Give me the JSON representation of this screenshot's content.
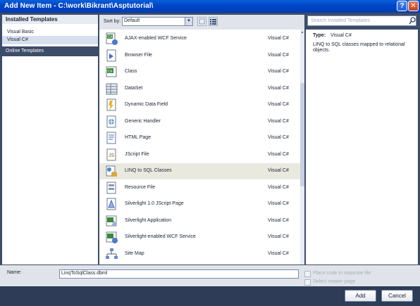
{
  "window": {
    "title": "Add New Item - C:\\work\\Bikrant\\Asptutorial\\",
    "help_glyph": "?",
    "close_glyph": "✕"
  },
  "left_panel": {
    "header": "Installed Templates",
    "items": [
      {
        "label": "Visual Basic",
        "selected": false
      },
      {
        "label": "Visual C#",
        "selected": true
      }
    ],
    "online": "Online Templates"
  },
  "toolbar": {
    "sort_label": "Sort by:",
    "sort_value": "Default"
  },
  "search": {
    "placeholder": "Search Installed Templates"
  },
  "templates": [
    {
      "name": "AJAX-enabled WCF Service",
      "lang": "Visual C#",
      "icon": "wcf-service-icon"
    },
    {
      "name": "Browser File",
      "lang": "Visual C#",
      "icon": "browser-file-icon"
    },
    {
      "name": "Class",
      "lang": "Visual C#",
      "icon": "class-icon"
    },
    {
      "name": "DataSet",
      "lang": "Visual C#",
      "icon": "dataset-icon"
    },
    {
      "name": "Dynamic Data Field",
      "lang": "Visual C#",
      "icon": "dynamic-data-field-icon"
    },
    {
      "name": "Generic Handler",
      "lang": "Visual C#",
      "icon": "generic-handler-icon"
    },
    {
      "name": "HTML Page",
      "lang": "Visual C#",
      "icon": "html-page-icon"
    },
    {
      "name": "JScript File",
      "lang": "Visual C#",
      "icon": "jscript-file-icon"
    },
    {
      "name": "LINQ to SQL Classes",
      "lang": "Visual C#",
      "icon": "linq-to-sql-icon",
      "selected": true
    },
    {
      "name": "Resource File",
      "lang": "Visual C#",
      "icon": "resource-file-icon"
    },
    {
      "name": "Silverlight 1.0 JScript Page",
      "lang": "Visual C#",
      "icon": "silverlight-jscript-page-icon"
    },
    {
      "name": "Silverlight Application",
      "lang": "Visual C#",
      "icon": "silverlight-application-icon"
    },
    {
      "name": "Silverlight-enabled WCF Service",
      "lang": "Visual C#",
      "icon": "silverlight-wcf-service-icon"
    },
    {
      "name": "Site Map",
      "lang": "Visual C#",
      "icon": "site-map-icon"
    }
  ],
  "details": {
    "type_label": "Type:",
    "type_value": "Visual C#",
    "description": "LINQ to SQL classes mapped to relational objects."
  },
  "name_field": {
    "label": "Name:",
    "value": "LinqToSqlClass.dbml"
  },
  "options": {
    "separate_file": "Place code in separate file",
    "master_page": "Select master page"
  },
  "buttons": {
    "add": "Add",
    "cancel": "Cancel"
  },
  "colors": {
    "selected_row": "#eae9e0",
    "titlebar": "#0047c8",
    "frame": "#3c4c69"
  }
}
